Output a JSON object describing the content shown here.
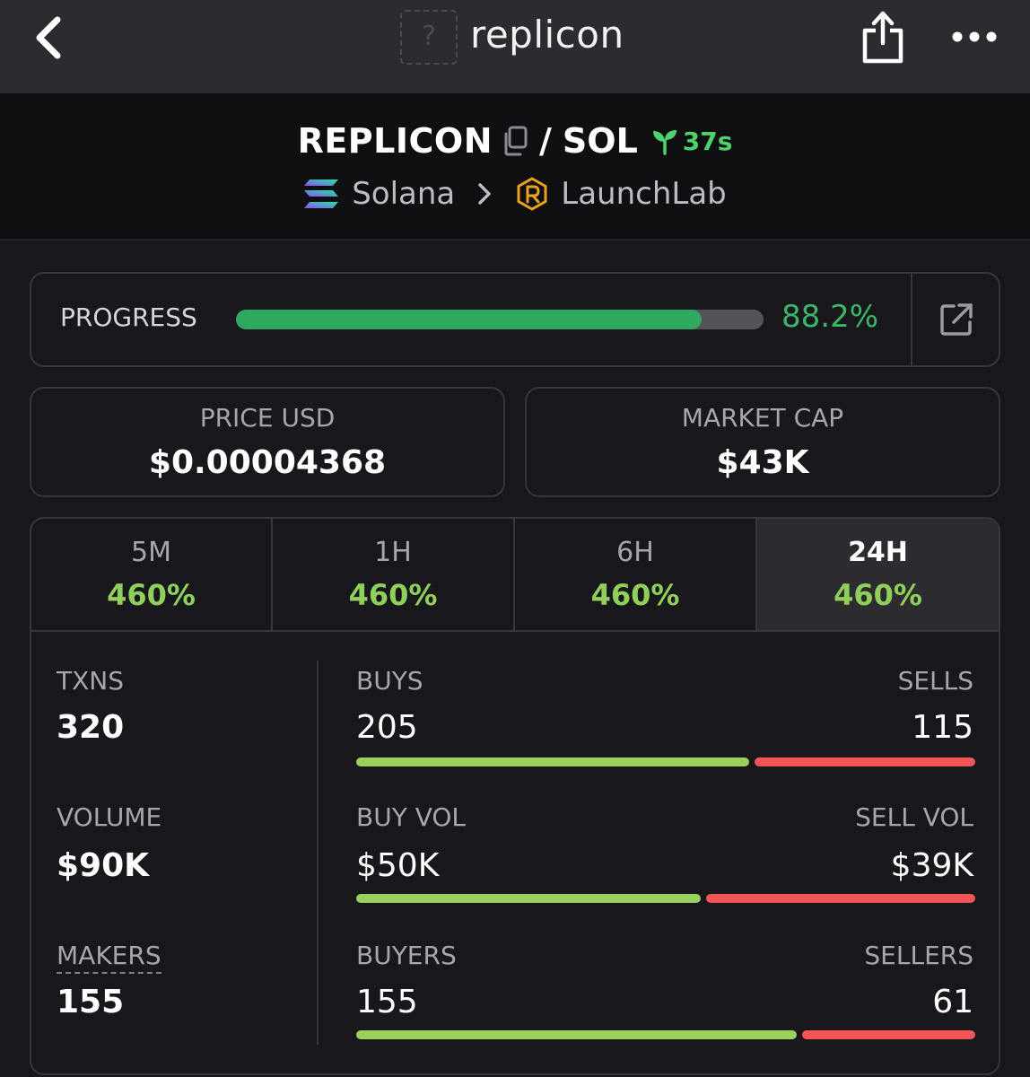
{
  "nav": {
    "title": "replicon",
    "thumb_placeholder": "?",
    "icons": [
      "chevron-left-icon",
      "share-icon",
      "more-horizontal-icon"
    ]
  },
  "pair": {
    "base": "REPLICON",
    "separator": "/",
    "quote": "SOL",
    "age": "37s",
    "chain": "Solana",
    "dex": "LaunchLab"
  },
  "progress": {
    "label": "PROGRESS",
    "value_text": "88.2%",
    "fraction": 0.882
  },
  "stats": {
    "price_label": "PRICE USD",
    "price_value": "$0.00004368",
    "mcap_label": "MARKET CAP",
    "mcap_value": "$43K"
  },
  "tabs": [
    {
      "label": "5M",
      "change": "460%",
      "active": false
    },
    {
      "label": "1H",
      "change": "460%",
      "active": false
    },
    {
      "label": "6H",
      "change": "460%",
      "active": false
    },
    {
      "label": "24H",
      "change": "460%",
      "active": true
    }
  ],
  "metrics": {
    "txns_label": "TXNS",
    "txns_value": "320",
    "volume_label": "VOLUME",
    "volume_value": "$90K",
    "makers_label": "MAKERS",
    "makers_value": "155",
    "buys_label": "BUYS",
    "buys_value": "205",
    "sells_label": "SELLS",
    "sells_value": "115",
    "buy_fraction_txns": 0.6406,
    "buyvol_label": "BUY VOL",
    "buyvol_value": "$50K",
    "sellvol_label": "SELL VOL",
    "sellvol_value": "$39K",
    "buy_fraction_vol": 0.5618,
    "buyers_label": "BUYERS",
    "buyers_value": "155",
    "sellers_label": "SELLERS",
    "sellers_value": "61",
    "buy_fraction_makers": 0.7176
  },
  "colors": {
    "accent_green": "#3ab56a",
    "change_green": "#8fcf5a",
    "buy_bar": "#99d25c",
    "sell_bar": "#f25557"
  }
}
